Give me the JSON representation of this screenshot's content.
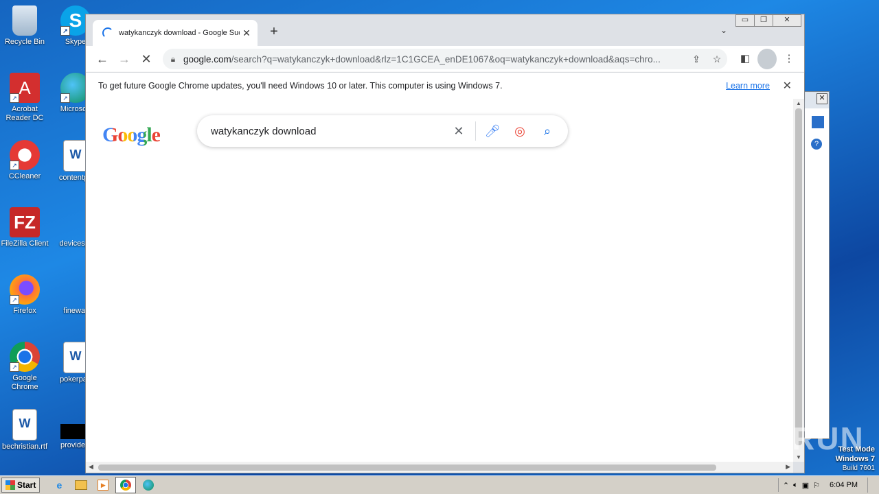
{
  "desktop": {
    "icons": [
      {
        "label": "Recycle Bin"
      },
      {
        "label": "Skype"
      },
      {
        "label": "Acrobat Reader DC"
      },
      {
        "label": "Microsoft"
      },
      {
        "label": "CCleaner"
      },
      {
        "label": "contentpa"
      },
      {
        "label": "FileZilla Client"
      },
      {
        "label": "devicespr"
      },
      {
        "label": "Firefox"
      },
      {
        "label": "finewar"
      },
      {
        "label": "Google Chrome"
      },
      {
        "label": "pokerpan"
      },
      {
        "label": "bechristian.rtf"
      },
      {
        "label": "providefil"
      }
    ]
  },
  "browser": {
    "tab": {
      "title": "watykanczyk download - Google Suc"
    },
    "address": {
      "host": "google.com",
      "path": "/search?q=watykanczyk+download&rlz=1C1GCEA_enDE1067&oq=watykanczyk+download&aqs=chro..."
    },
    "infobar": {
      "message": "To get future Google Chrome updates, you'll need Windows 10 or later. This computer is using Windows 7.",
      "link": "Learn more"
    },
    "page": {
      "logo": "Google",
      "query": "watykanczyk download"
    }
  },
  "overlay": {
    "watermark": "ANY RUN",
    "testmode": {
      "line1": "Test Mode",
      "line2": "Windows 7",
      "line3": "Build 7601"
    }
  },
  "taskbar": {
    "start": "Start",
    "clock": "6:04 PM"
  },
  "colors": {
    "accent": "#1a73e8",
    "taskbar": "#d4d0c8"
  }
}
